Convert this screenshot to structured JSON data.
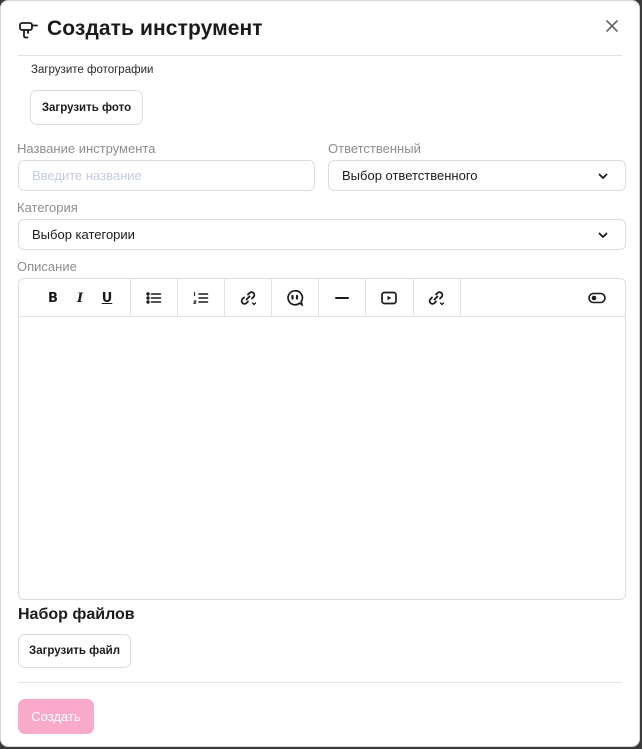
{
  "modal": {
    "title": "Создать инструмент",
    "photo_label": "Загрузите фотографии",
    "photo_button": "Загрузить фото",
    "name": {
      "label": "Название инструмента",
      "placeholder": "Введите название"
    },
    "responsible": {
      "label": "Ответственный",
      "value": "Выбор ответственного"
    },
    "category": {
      "label": "Категория",
      "value": "Выбор категории"
    },
    "description": {
      "label": "Описание"
    },
    "files": {
      "title": "Набор файлов",
      "button": "Загрузить файл"
    },
    "create_button": "Создать"
  },
  "toolbar": {
    "bold": "B",
    "italic": "I",
    "underline": "U"
  },
  "colors": {
    "accent_disabled": "#f9aacb",
    "border": "#dcdcdc",
    "label": "#8e8e8e"
  },
  "icons": [
    "drill-icon",
    "close-icon",
    "chevron-down-icon",
    "bullet-list-icon",
    "ordered-list-icon",
    "link-icon",
    "quote-icon",
    "horizontal-rule-icon",
    "video-icon",
    "unlink-icon",
    "toggle-icon"
  ]
}
